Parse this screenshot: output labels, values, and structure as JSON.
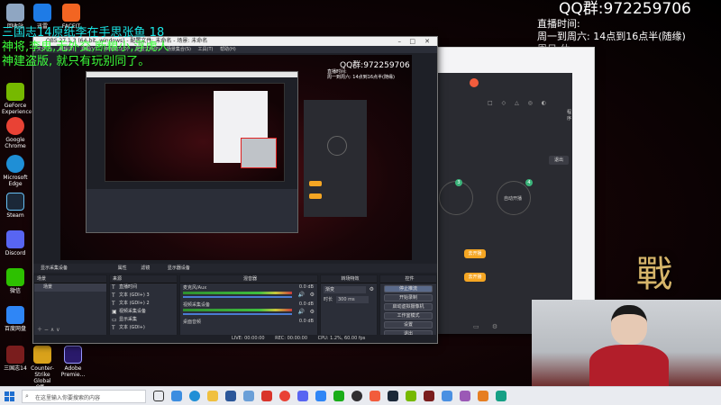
{
  "qq_group": {
    "label": "QQ群:",
    "number": "972259706"
  },
  "schedule": {
    "line1": "直播时间:",
    "line2": "周一到周六:  14点到16点半(随缘)",
    "line3": "周日 休"
  },
  "overlay_title": {
    "line1": "三国志14原纸李在手思张鱼 18",
    "line2": "神将,李鬼,无外交,断粮小,浮虎人",
    "line3": "神建盗版, 就只有玩别同了。"
  },
  "desktop_icons": [
    {
      "label": "回收站",
      "color": "#8fa6c2"
    },
    {
      "label": "迅雷",
      "color": "#1e7be6"
    },
    {
      "label": "FACEIT",
      "color": "#f26522"
    },
    {
      "label": "GeForce Experience",
      "color": "#76b900"
    },
    {
      "label": "Google Chrome",
      "color": "#e94235"
    },
    {
      "label": "Microsoft Edge",
      "color": "#1f8fd6"
    },
    {
      "label": "Steam",
      "color": "#1b2838"
    },
    {
      "label": "Discord",
      "color": "#5865f2"
    },
    {
      "label": "微信",
      "color": "#2dc100"
    },
    {
      "label": "百度网盘",
      "color": "#2f86f6"
    },
    {
      "label": "三国志14",
      "color": "#7a1d1d"
    },
    {
      "label": "Counter-Strike Global Off...",
      "color": "#d9a21b"
    },
    {
      "label": "Adobe Premie...",
      "color": "#2a1a6b"
    }
  ],
  "obs": {
    "title": "OBS 27.1.3 (64-bit, windows) - 配置文件: 未命名 - 场景: 未命名",
    "menu": [
      "文件(F)",
      "编辑(E)",
      "视图(V)",
      "停靠窗口(D)",
      "配置文件(P)",
      "场景集合(S)",
      "工具(T)",
      "帮助(H)"
    ],
    "source_tabs": {
      "display_capture": "显示采集设备",
      "properties": "属性",
      "filters": "滤镜",
      "display": "显示器设备"
    },
    "scenes_header": "场景",
    "scenes_items": [
      "场景"
    ],
    "sources_header": "来源",
    "sources": [
      "直播时间",
      "文本 (GDI+) 3",
      "文本 (GDI+) 2",
      "视频采集设备",
      "显示采集",
      "文本 (GDI+)",
      "图像"
    ],
    "mixer_header": "混音器",
    "mixer_tracks": [
      {
        "name": "麦克风/Aux",
        "db": "0.0 dB"
      },
      {
        "name": "视频采集设备",
        "db": "0.0 dB"
      },
      {
        "name": "桌面音频",
        "db": "0.0 dB"
      }
    ],
    "transitions_header": "转场特效",
    "transition_select": "渐变",
    "duration_label": "时长",
    "duration_value": "300 ms",
    "controls_header": "控件",
    "controls": [
      "停止推流",
      "开始录制",
      "启动虚拟摄像机",
      "工作室模式",
      "设置",
      "退出"
    ],
    "status": {
      "live": "LIVE: 00:00:00",
      "rec": "REC: 00:00:00",
      "cpu": "CPU: 1.2%, 60.00 fps"
    }
  },
  "client_panel": {
    "exit_button": "退出",
    "program_label": "程序",
    "auto_open_label": "自动开播",
    "badge1": "3",
    "badge2": "4",
    "orange1": "去开播",
    "orange2": "去开播"
  },
  "taskbar": {
    "search_placeholder": "在这里输入你要搜索的内容",
    "weather": "6°C 晴朗",
    "time": "14:27",
    "date": "2022/1/17"
  },
  "colors": {
    "accent_orange": "#f5a623",
    "obs_bg": "#2b2e38",
    "overlay_cyan": "#19e6e6",
    "overlay_green": "#3cff3c",
    "webcam_border": "#e02020"
  }
}
